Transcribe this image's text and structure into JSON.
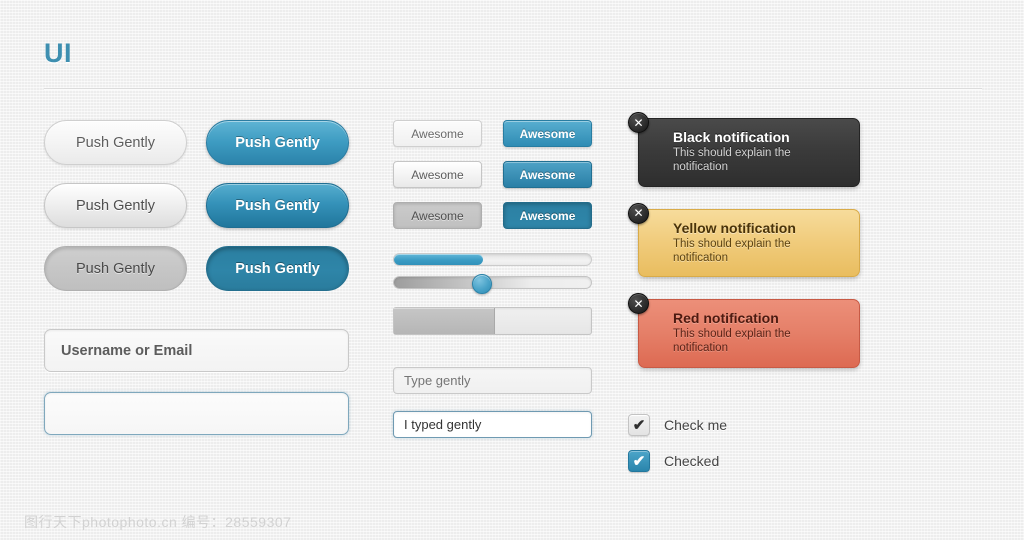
{
  "header": {
    "title": "UI"
  },
  "buttons": {
    "pill_label": "Push Gently",
    "small_label": "Awesome",
    "states": [
      "normal",
      "hover",
      "pressed"
    ]
  },
  "inputs": {
    "username": {
      "value": "Username or Email",
      "placeholder": "Username or Email"
    },
    "focused_empty": {
      "value": "",
      "placeholder": ""
    },
    "type_gently": {
      "value": "",
      "placeholder": "Type gently"
    },
    "typed_gently": {
      "value": "I typed gently",
      "placeholder": ""
    }
  },
  "progress": {
    "blue_bar_percent": 45,
    "slider_percent": 44,
    "gray_bar_percent": 51
  },
  "notifications": [
    {
      "variant": "black",
      "title": "Black notification",
      "body": "This should explain the notification",
      "close_icon": "close-icon",
      "close_glyph": "✕"
    },
    {
      "variant": "yellow",
      "title": "Yellow notification",
      "body": "This should explain the notification",
      "close_icon": "close-icon",
      "close_glyph": "✕"
    },
    {
      "variant": "red",
      "title": "Red notification",
      "body": "This should explain the notification",
      "close_icon": "close-icon",
      "close_glyph": "✕"
    }
  ],
  "checkboxes": [
    {
      "label": "Check me",
      "checked": true,
      "style": "gray",
      "glyph": "✔"
    },
    {
      "label": "Checked",
      "checked": true,
      "style": "blue",
      "glyph": "✔"
    }
  ],
  "colors": {
    "accent_blue": "#3e9cc2",
    "title_blue": "#3e8fb0",
    "notification_black": "#3b3b3b",
    "notification_yellow": "#f0cb7b",
    "notification_red": "#e57f68",
    "background": "#f2f2f2"
  },
  "watermark": {
    "text": "图行天下photophoto.cn  编号：28559307"
  }
}
